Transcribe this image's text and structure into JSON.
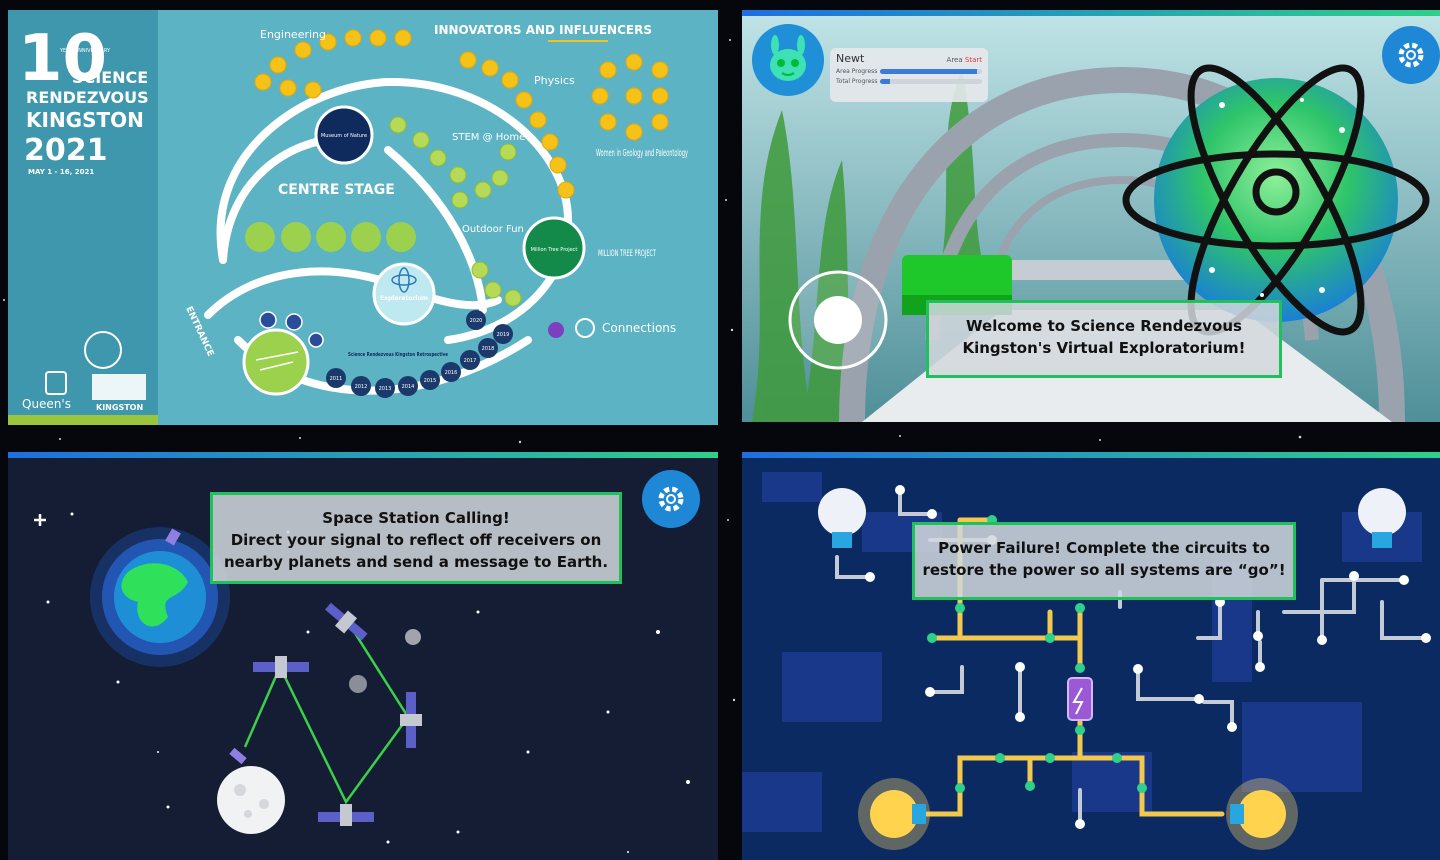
{
  "map_panel": {
    "logo": {
      "anniversary_number": "10",
      "anniversary_text": "YEAR ANNIVERSARY",
      "line1": "SCIENCE",
      "line2": "RENDEZVOUS",
      "line3": "KINGSTON",
      "year": "2021",
      "dates": "MAY 1 - 16, 2021"
    },
    "sponsors": {
      "queens": "Queen's",
      "kingston": "KINGSTON"
    },
    "zones": {
      "engineering": "Engineering",
      "innovators": "INNOVATORS AND INFLUENCERS",
      "physics": "Physics",
      "women_geology": "Women in Geology and Paleontology",
      "museum": "Museum of Nature",
      "stem_home": "STEM @ Home",
      "centre_stage": "CENTRE STAGE",
      "outdoor_fun": "Outdoor Fun",
      "million_tree_node": "Million Tree Project",
      "million_tree_logo": "MILLION TREE PROJECT",
      "exploratorium": "Exploratorium",
      "entrance": "ENTRANCE",
      "connections": "Connections",
      "retrospective": "Science Rendezvous Kingston Retrospective"
    },
    "retrospective_years": [
      "2011",
      "2012",
      "2013",
      "2014",
      "2015",
      "2016",
      "2017",
      "2018",
      "2019",
      "2020"
    ]
  },
  "exploratorium_panel": {
    "player_name": "Newt",
    "area_label": "Area",
    "area_value": "Start",
    "area_progress_label": "Area Progress",
    "total_progress_label": "Total Progress",
    "area_progress": 0.95,
    "total_progress": 0.1,
    "welcome_line1": "Welcome to Science Rendezvous",
    "welcome_line2": "Kingston's Virtual Exploratorium!"
  },
  "space_panel": {
    "message_line1": "Space Station Calling!",
    "message_line2": "Direct your signal to reflect off receivers on",
    "message_line3": "nearby planets and send a message to Earth."
  },
  "circuit_panel": {
    "message_line1": "Power Failure! Complete the circuits to",
    "message_line2": "restore the power so all systems are “go”!"
  },
  "colors": {
    "accent_blue": "#1e88d6",
    "accent_green": "#2fd08a",
    "map_background": "#5cb3c4",
    "gold_node": "#f5c21a",
    "wire_yellow": "#f2c94c"
  }
}
